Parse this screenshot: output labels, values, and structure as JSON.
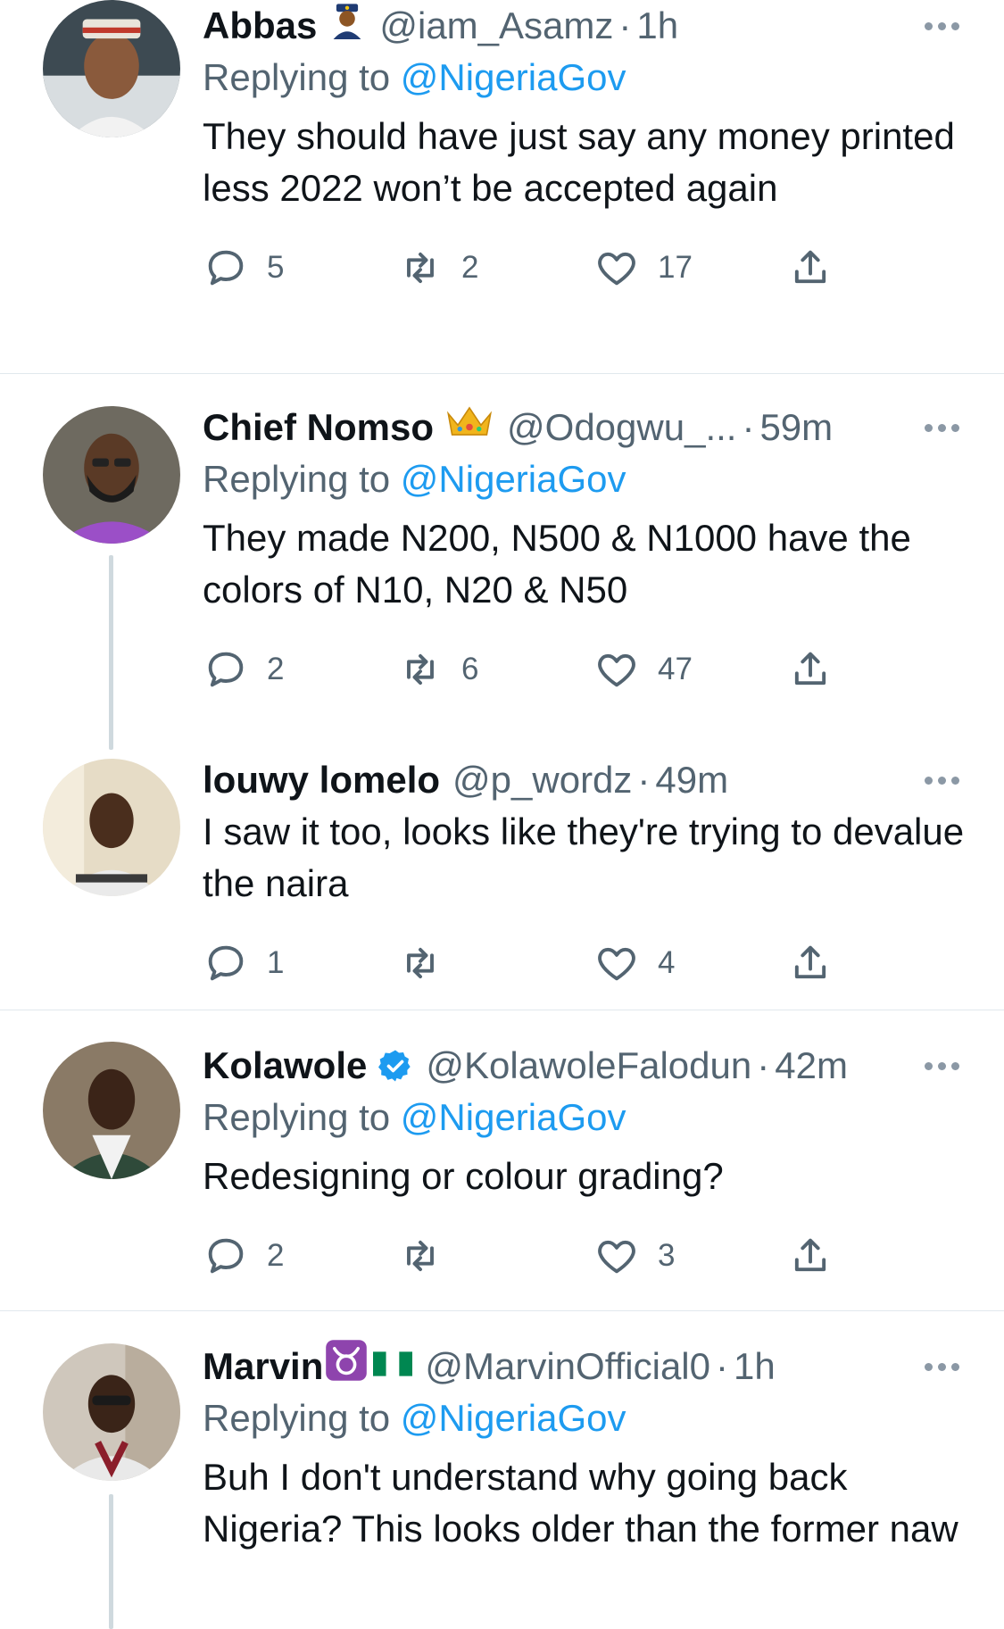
{
  "colors": {
    "link": "#1d9bf0",
    "secondary_text": "#536471",
    "primary_text": "#0f1419",
    "divider": "#e1e8ed",
    "verified": "#1d9bf0"
  },
  "tweets": [
    {
      "name": "Abbas",
      "emoji": "police-officer-emoji",
      "handle": "@iam_Asamz",
      "separator": "·",
      "time": "1h",
      "replying_prefix": "Replying to ",
      "replying_to": "@NigeriaGov",
      "text": "They should have just say any money printed less 2022 won’t be accepted again",
      "replies": "5",
      "retweets": "2",
      "likes": "17"
    },
    {
      "name": "Chief Nomso",
      "emoji": "crown-emoji",
      "handle": "@Odogwu_...",
      "separator": "·",
      "time": "59m",
      "replying_prefix": "Replying to ",
      "replying_to": "@NigeriaGov",
      "text": "They made N200, N500 & N1000 have the colors of N10, N20 & N50",
      "replies": "2",
      "retweets": "6",
      "likes": "47"
    },
    {
      "name": "louwy lomelo",
      "handle": "@p_wordz",
      "separator": "·",
      "time": "49m",
      "text": "I saw it too, looks like they're trying to devalue the naira",
      "replies": "1",
      "retweets": "",
      "likes": "4"
    },
    {
      "name": "Kolawole",
      "emoji": "verified-badge-icon",
      "handle": "@KolawoleFalodun",
      "separator": "·",
      "time": "42m",
      "replying_prefix": "Replying to ",
      "replying_to": "@NigeriaGov",
      "text": "Redesigning or colour grading?",
      "replies": "2",
      "retweets": "",
      "likes": "3"
    },
    {
      "name": "Marvin",
      "emoji": "taurus-emoji nigeria-flag-emoji",
      "handle": "@MarvinOfficial0",
      "separator": "·",
      "time": "1h",
      "replying_prefix": "Replying to ",
      "replying_to": "@NigeriaGov",
      "text": "Buh I don't understand why going back Nigeria? This looks older than the former naw"
    }
  ]
}
